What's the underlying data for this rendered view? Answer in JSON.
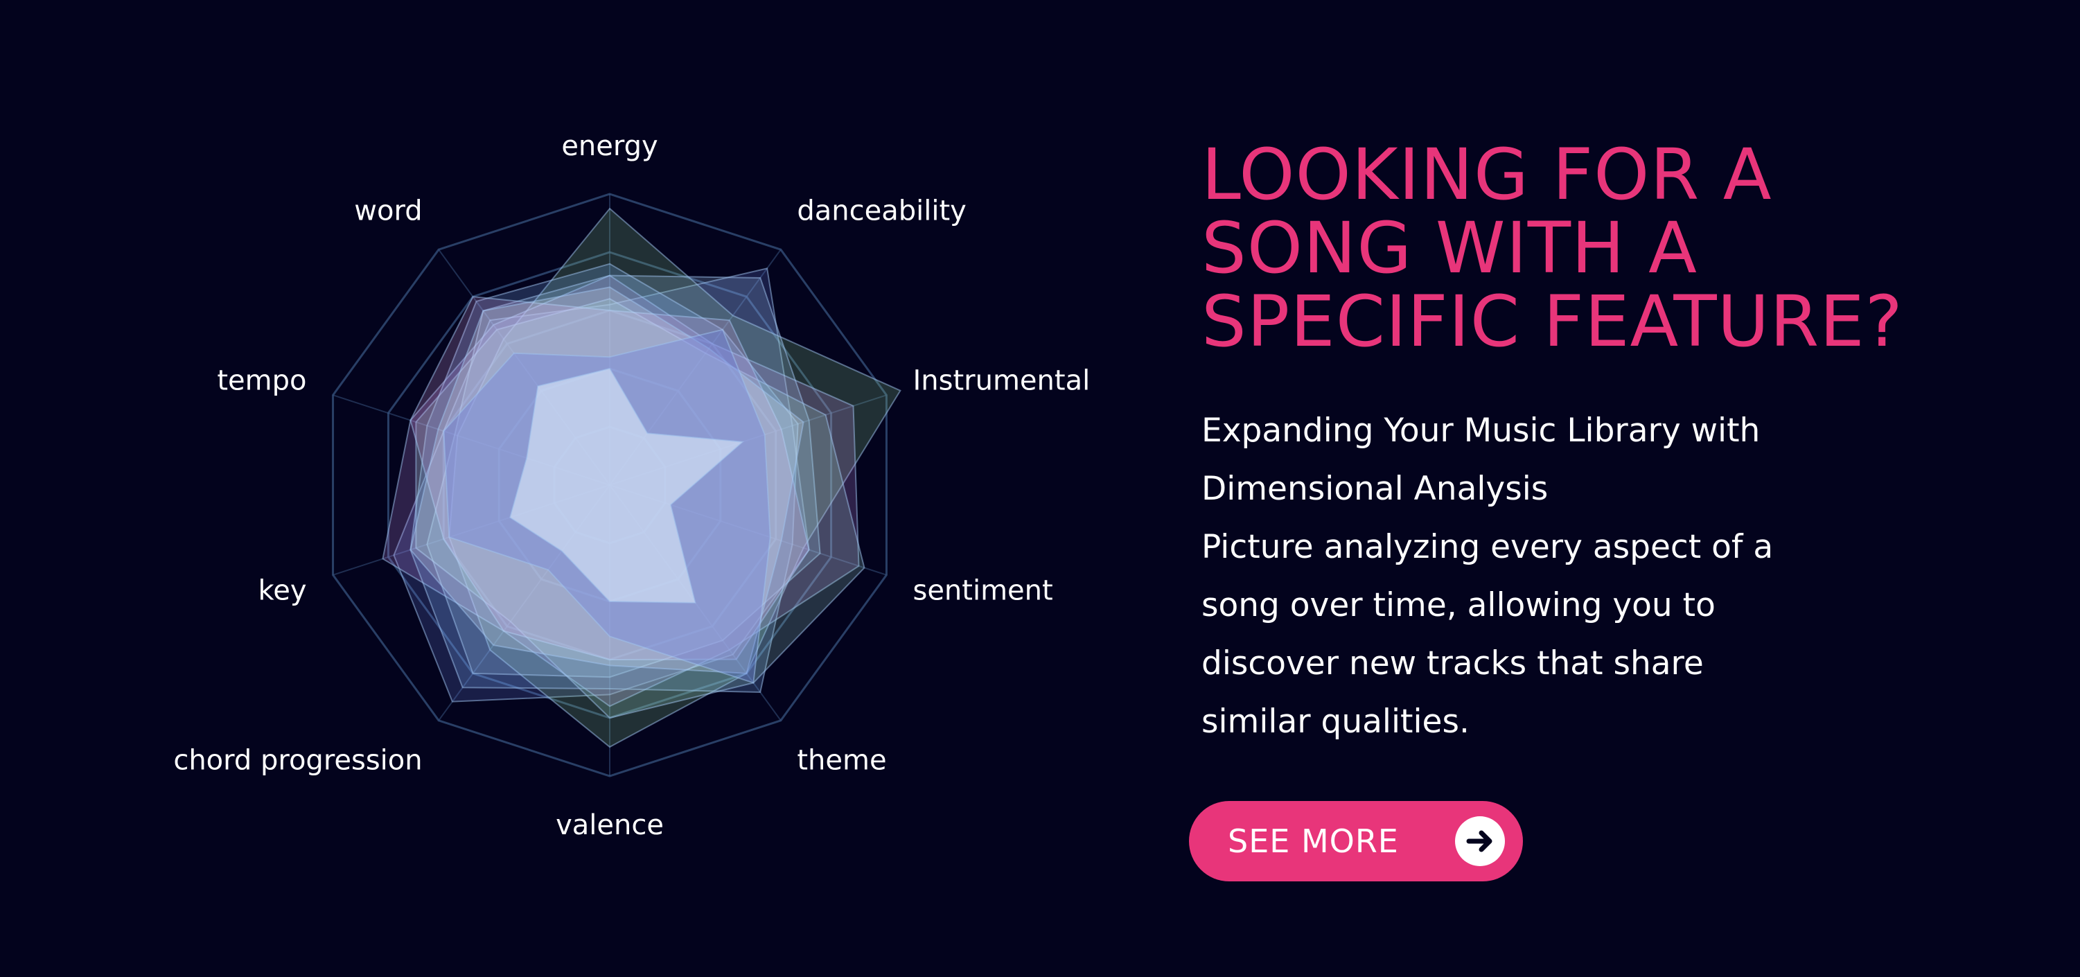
{
  "radar": {
    "axes": [
      "energy",
      "danceability",
      "Instrumental",
      "sentiment",
      "theme",
      "valence",
      "chord progression",
      "key",
      "tempo",
      "word"
    ],
    "rings": 5,
    "colors": {
      "grid": "#3b5a86",
      "fills": [
        "#6a7fe0",
        "#8fd18f",
        "#c58fe6",
        "#7fb8ff",
        "#a0c8f0",
        "#9ad6c8",
        "#d9a6e8",
        "#e6f0ff"
      ]
    },
    "series": [
      [
        0.62,
        0.92,
        0.66,
        0.72,
        0.72,
        0.72,
        0.92,
        0.78,
        0.6,
        0.7
      ],
      [
        0.95,
        0.72,
        1.05,
        0.7,
        0.8,
        0.9,
        0.7,
        0.58,
        0.55,
        0.62
      ],
      [
        0.72,
        0.6,
        0.88,
        0.9,
        0.7,
        0.76,
        0.62,
        0.82,
        0.72,
        0.68
      ],
      [
        0.76,
        0.66,
        0.68,
        0.66,
        0.88,
        0.7,
        0.86,
        0.72,
        0.66,
        0.78
      ],
      [
        0.72,
        0.88,
        0.72,
        0.76,
        0.66,
        0.66,
        0.8,
        0.66,
        0.56,
        0.74
      ],
      [
        0.64,
        0.56,
        0.78,
        0.92,
        0.84,
        0.8,
        0.58,
        0.7,
        0.7,
        0.66
      ],
      [
        0.6,
        0.7,
        0.62,
        0.72,
        0.74,
        0.6,
        0.62,
        0.6,
        0.72,
        0.8
      ],
      [
        0.68,
        0.58,
        0.7,
        0.62,
        0.8,
        0.62,
        0.68,
        0.72,
        0.62,
        0.74
      ],
      [
        0.44,
        0.66,
        0.56,
        0.58,
        0.84,
        0.52,
        0.36,
        0.58,
        0.6,
        0.56
      ],
      [
        0.4,
        0.22,
        0.48,
        0.22,
        0.5,
        0.4,
        0.28,
        0.36,
        0.3,
        0.42
      ]
    ]
  },
  "headline": {
    "line1": "LOOKING FOR A",
    "line2": "SONG WITH A",
    "line3": "SPECIFIC FEATURE?"
  },
  "body": {
    "line1": "Expanding Your Music Library with",
    "line2": "Dimensional Analysis",
    "line3": "Picture analyzing every aspect of a",
    "line4": "song over time, allowing you to",
    "line5": "discover new tracks that share",
    "line6": "similar qualities."
  },
  "cta": {
    "label": "SEE MORE",
    "icon": "arrow-right-icon"
  },
  "colors": {
    "background": "#03031d",
    "accent": "#e8357a",
    "text": "#ffffff"
  }
}
